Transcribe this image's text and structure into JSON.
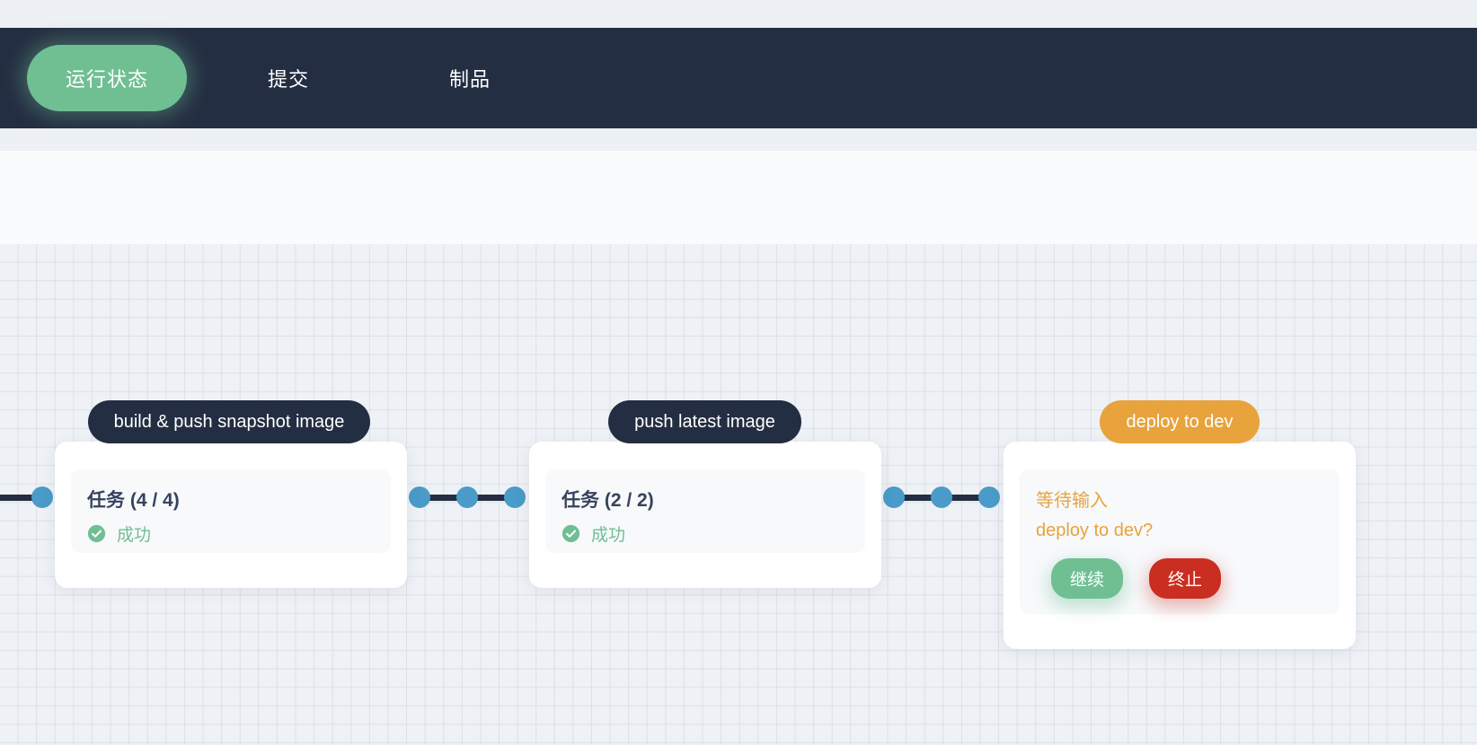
{
  "nav": {
    "tabs": [
      {
        "label": "运行状态",
        "active": true
      },
      {
        "label": "提交",
        "active": false
      },
      {
        "label": "制品",
        "active": false
      }
    ]
  },
  "colors": {
    "nav_background": "#242e42",
    "accent_green": "#6fbf93",
    "accent_orange": "#e8a33d",
    "accent_red": "#ca2e21",
    "connector_dot": "#4a9bc9",
    "connector_line": "#242e42",
    "canvas_background": "#eef1f5"
  },
  "pipeline": {
    "stages": [
      {
        "name": "build & push snapshot image",
        "state": "success",
        "task_label": "任务 (4 / 4)",
        "status_icon": "check-circle-icon",
        "status_text": "成功"
      },
      {
        "name": "push latest image",
        "state": "success",
        "task_label": "任务 (2 / 2)",
        "status_icon": "check-circle-icon",
        "status_text": "成功"
      },
      {
        "name": "deploy to dev",
        "state": "waiting",
        "wait_label": "等待输入",
        "wait_question": "deploy to dev?",
        "buttons": [
          {
            "label": "继续",
            "kind": "confirm"
          },
          {
            "label": "终止",
            "kind": "abort"
          }
        ]
      }
    ]
  }
}
